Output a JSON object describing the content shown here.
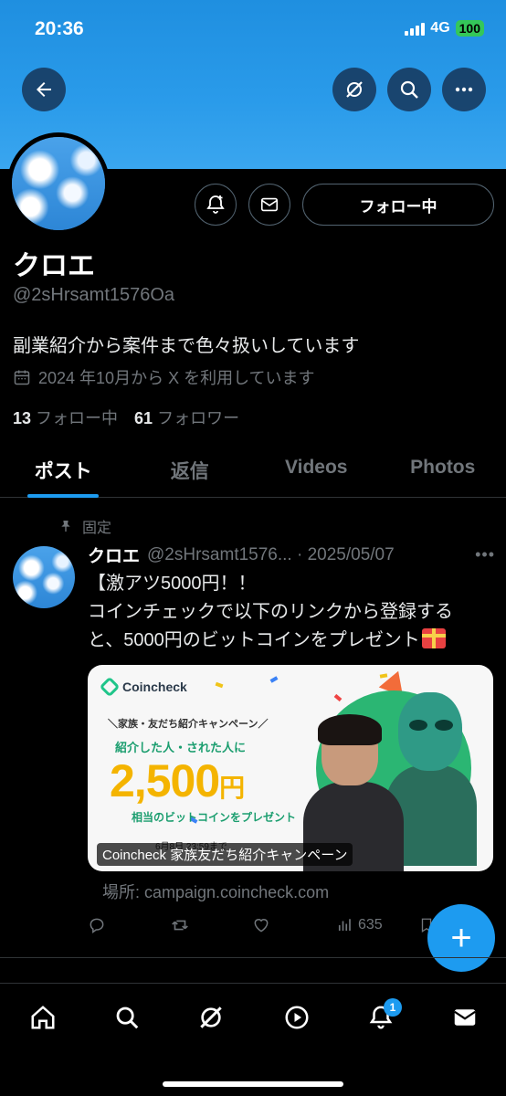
{
  "status": {
    "time": "20:36",
    "network": "4G",
    "battery": "100"
  },
  "profile": {
    "name": "クロエ",
    "handle": "@2sHrsamt1576Oa",
    "bio": "副業紹介から案件まで色々扱いしています",
    "joined": "2024 年10月から X を利用しています",
    "following_count": "13",
    "following_label": "フォロー中",
    "followers_count": "61",
    "followers_label": "フォロワー",
    "follow_button": "フォロー中"
  },
  "tabs": [
    {
      "label": "ポスト",
      "active": true
    },
    {
      "label": "返信",
      "active": false
    },
    {
      "label": "Videos",
      "active": false
    },
    {
      "label": "Photos",
      "active": false
    }
  ],
  "post": {
    "pinned_label": "固定",
    "name": "クロエ",
    "handle_date": "@2sHrsamt1576... · 2025/05/07",
    "text_lines": [
      "【激アツ5000円！！",
      "コインチェックで以下のリンクから登録する",
      "と、5000円のビットコインをプレゼント"
    ],
    "card": {
      "brand": "Coincheck",
      "sub": "＼家族・友だち紹介キャンペーン／",
      "line": "紹介した人・された人に",
      "amount": "2,500",
      "amount_unit": "円",
      "bottom": "相当のビットコインをプレゼント",
      "date": "6月8日 23:59まで",
      "caption": "Coincheck 家族友だち紹介キャンペーン",
      "source": "場所: campaign.coincheck.com"
    },
    "views": "635"
  },
  "nav": {
    "notifications_badge": "1"
  },
  "colors": {
    "accent": "#1d9bf0",
    "banner": "#2a9bea"
  }
}
